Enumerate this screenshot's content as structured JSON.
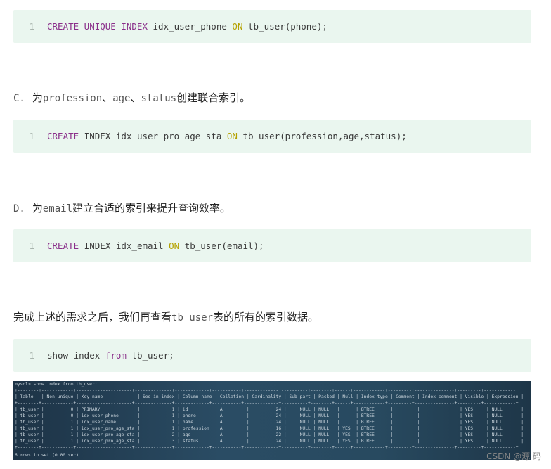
{
  "code_blocks": [
    {
      "line_no": "1",
      "kw1": "CREATE UNIQUE INDEX",
      "mid": " idx_user_phone ",
      "kw2": "ON",
      "tail": " tb_user(phone);"
    },
    {
      "line_no": "1",
      "kw1": "CREATE",
      "mid": " INDEX idx_user_pro_age_sta ",
      "kw2": "ON",
      "tail": " tb_user(profession,age,status);"
    },
    {
      "line_no": "1",
      "kw1": "CREATE",
      "mid": " INDEX idx_email ",
      "kw2": "ON",
      "tail": " tb_user(email);"
    },
    {
      "line_no": "1",
      "pre": "show index ",
      "kw1": "from",
      "tail": " tb_user;"
    }
  ],
  "paragraphs": {
    "c": {
      "prefix": "C.",
      "p1": "为",
      "code": "profession",
      "sep1": "、",
      "code2": "age",
      "sep2": "、",
      "code3": "status",
      "p2": "创建联合索引。"
    },
    "d": {
      "prefix": "D.",
      "p1": "为",
      "code": "email",
      "p2": "建立合适的索引来提升查询效率。"
    },
    "e": {
      "p1": "完成上述的需求之后，我们再查看",
      "code": "tb_user",
      "p2": "表的所有的索引数据。"
    }
  },
  "terminal": {
    "prompt": "mysql> show index from tb_user;",
    "sep": "+--------+------------+---------------------+--------------+-------------+-----------+-------------+----------+--------+------+------------+---------+---------------+---------+------------+",
    "header": "| Table   | Non_unique | Key_name             | Seq_in_index | Column_name | Collation | Cardinality | Sub_part | Packed | Null | Index_type | Comment | Index_comment | Visible | Expression |",
    "rows": [
      "| tb_user |          0 | PRIMARY              |            1 | id          | A         |          24 |     NULL | NULL   |      | BTREE      |         |               | YES     | NULL       |",
      "| tb_user |          0 | idx_user_phone       |            1 | phone       | A         |          24 |     NULL | NULL   |      | BTREE      |         |               | YES     | NULL       |",
      "| tb_user |          1 | idx_user_name        |            1 | name        | A         |          24 |     NULL | NULL   |      | BTREE      |         |               | YES     | NULL       |",
      "| tb_user |          1 | idx_user_pro_age_sta |            1 | profession  | A         |          16 |     NULL | NULL   | YES  | BTREE      |         |               | YES     | NULL       |",
      "| tb_user |          1 | idx_user_pro_age_sta |            2 | age         | A         |          22 |     NULL | NULL   | YES  | BTREE      |         |               | YES     | NULL       |",
      "| tb_user |          1 | idx_user_pro_age_sta |            3 | status      | A         |          24 |     NULL | NULL   | YES  | BTREE      |         |               | YES     | NULL       |"
    ],
    "footer": "6 rows in set (0.00 sec)"
  },
  "watermark": "CSDN @源 码"
}
